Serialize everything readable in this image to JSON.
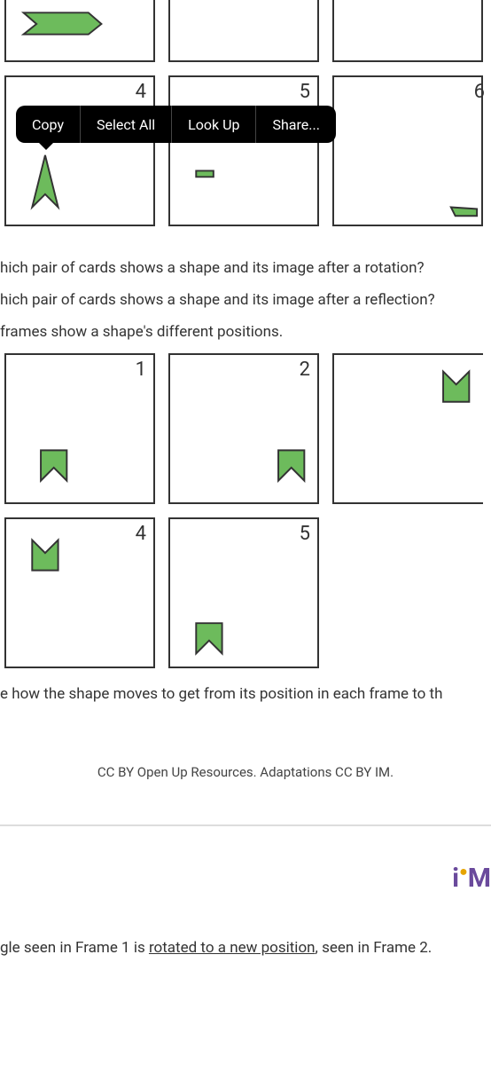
{
  "context_menu": {
    "copy": "Copy",
    "select_all": "Select All",
    "look_up": "Look Up",
    "share": "Share..."
  },
  "top_cards_row1": {
    "cards": [
      {
        "num": ""
      },
      {
        "num": ""
      },
      {
        "num": ""
      }
    ]
  },
  "top_cards_row2": {
    "cards": [
      {
        "num": "4"
      },
      {
        "num": "5"
      },
      {
        "num": "6"
      }
    ]
  },
  "questions": {
    "q1": "hich pair of cards shows a shape and its image after a rotation?",
    "q2": "hich pair of cards shows a shape and its image after a reflection?",
    "intro": "frames show a shape's different positions."
  },
  "frame_cards_row1": {
    "cards": [
      {
        "num": "1"
      },
      {
        "num": "2"
      },
      {
        "num": ""
      }
    ]
  },
  "frame_cards_row2": {
    "cards": [
      {
        "num": "4"
      },
      {
        "num": "5"
      },
      {
        "num": ""
      }
    ]
  },
  "after_frames": "e how the shape moves to get from its position in each frame to th",
  "attribution": "CC BY Open Up Resources. Adaptations CC BY IM.",
  "logo": {
    "i": "i",
    "m": "M"
  },
  "footer": {
    "prefix": "gle seen in Frame 1 is ",
    "underlined": "rotated to a new position",
    "suffix": ", seen in Frame 2."
  }
}
